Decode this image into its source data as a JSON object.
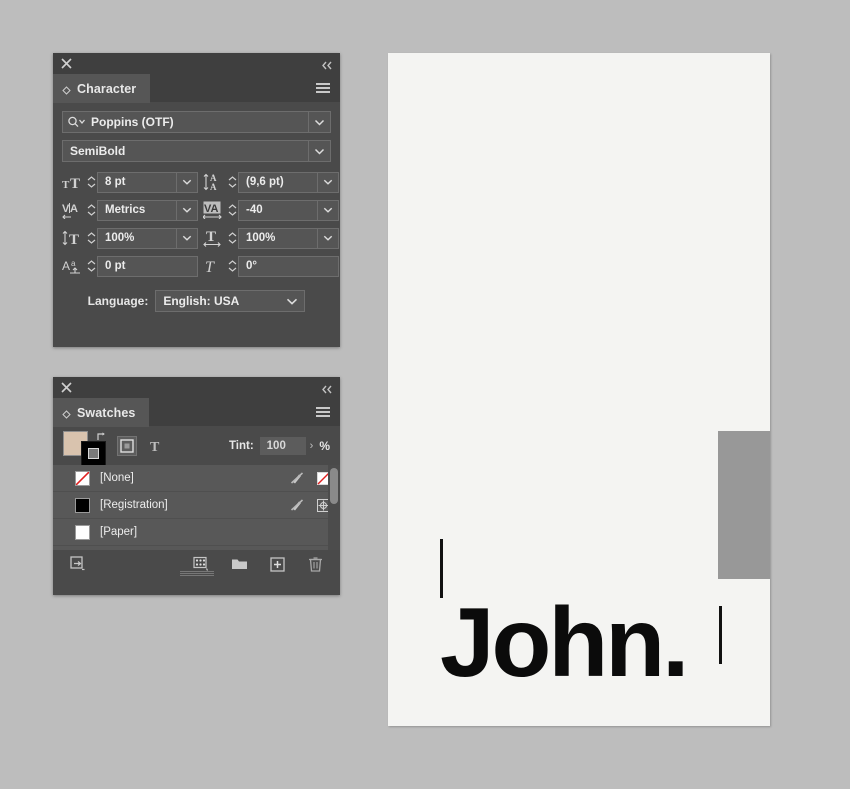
{
  "character_panel": {
    "tab_label": "Character",
    "close_icon": "close-icon",
    "collapse_icon": "double-chevron-left-icon",
    "menu_icon": "panel-menu-icon",
    "font_family": {
      "value": "Poppins (OTF)",
      "icon": "font-search-icon"
    },
    "font_style": {
      "value": "SemiBold"
    },
    "fields": [
      {
        "name": "font-size",
        "icon": "font-size-icon",
        "value": "8 pt",
        "has_dropdown": true
      },
      {
        "name": "leading",
        "icon": "leading-icon",
        "value": "(9,6 pt)",
        "has_dropdown": true
      },
      {
        "name": "kerning",
        "icon": "kerning-icon",
        "value": "Metrics",
        "has_dropdown": true
      },
      {
        "name": "tracking",
        "icon": "tracking-icon",
        "value": "-40",
        "has_dropdown": true
      },
      {
        "name": "vertical-scale",
        "icon": "vertical-scale-icon",
        "value": "100%",
        "has_dropdown": true
      },
      {
        "name": "horizontal-scale",
        "icon": "horizontal-scale-icon",
        "value": "100%",
        "has_dropdown": true
      },
      {
        "name": "baseline-shift",
        "icon": "baseline-shift-icon",
        "value": "0 pt",
        "has_dropdown": false
      },
      {
        "name": "skew",
        "icon": "skew-icon",
        "value": "0°",
        "has_dropdown": false
      }
    ],
    "language_label": "Language:",
    "language_value": "English: USA"
  },
  "swatches_panel": {
    "tab_label": "Swatches",
    "close_icon": "close-icon",
    "collapse_icon": "double-chevron-left-icon",
    "menu_icon": "panel-menu-icon",
    "fill_color": "#d9c3ae",
    "stroke_color": "#000000",
    "format_buttons": [
      {
        "name": "container-formatting-button",
        "icon": "frame-icon",
        "active": true
      },
      {
        "name": "text-formatting-button",
        "icon": "text-T-icon",
        "active": false
      }
    ],
    "tint_label": "Tint:",
    "tint_value": "100",
    "tint_unit": "%",
    "swatches": [
      {
        "name": "[None]",
        "chip": "none-diagonal",
        "lock_icon": "pen-crossed-icon",
        "type_icon": "none-swatch-icon"
      },
      {
        "name": "[Registration]",
        "chip": "#000000",
        "lock_icon": "pen-crossed-icon",
        "type_icon": "registration-icon"
      },
      {
        "name": "[Paper]",
        "chip": "#ffffff",
        "lock_icon": "",
        "type_icon": ""
      }
    ],
    "footer_icons": [
      {
        "name": "show-all-swatches-button",
        "icon": "show-all-icon"
      },
      {
        "name": "new-color-group-button",
        "icon": "color-group-icon"
      },
      {
        "name": "new-folder-button",
        "icon": "folder-icon"
      },
      {
        "name": "new-swatch-button",
        "icon": "new-swatch-icon"
      },
      {
        "name": "delete-swatch-button",
        "icon": "trash-icon"
      }
    ]
  },
  "document": {
    "headline": "John.",
    "page_background": "#f4f4f2",
    "rectangle_color": "#989898",
    "rule_color": "#111111"
  }
}
